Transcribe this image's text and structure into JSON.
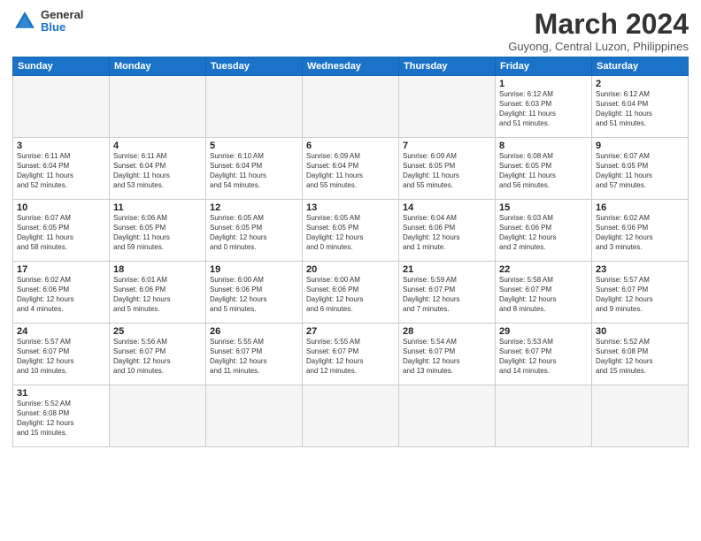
{
  "header": {
    "logo_line1": "General",
    "logo_line2": "Blue",
    "title": "March 2024",
    "subtitle": "Guyong, Central Luzon, Philippines"
  },
  "days_of_week": [
    "Sunday",
    "Monday",
    "Tuesday",
    "Wednesday",
    "Thursday",
    "Friday",
    "Saturday"
  ],
  "weeks": [
    [
      {
        "day": "",
        "info": "",
        "empty": true
      },
      {
        "day": "",
        "info": "",
        "empty": true
      },
      {
        "day": "",
        "info": "",
        "empty": true
      },
      {
        "day": "",
        "info": "",
        "empty": true
      },
      {
        "day": "",
        "info": "",
        "empty": true
      },
      {
        "day": "1",
        "info": "Sunrise: 6:12 AM\nSunset: 6:03 PM\nDaylight: 11 hours\nand 51 minutes."
      },
      {
        "day": "2",
        "info": "Sunrise: 6:12 AM\nSunset: 6:04 PM\nDaylight: 11 hours\nand 51 minutes."
      }
    ],
    [
      {
        "day": "3",
        "info": "Sunrise: 6:11 AM\nSunset: 6:04 PM\nDaylight: 11 hours\nand 52 minutes."
      },
      {
        "day": "4",
        "info": "Sunrise: 6:11 AM\nSunset: 6:04 PM\nDaylight: 11 hours\nand 53 minutes."
      },
      {
        "day": "5",
        "info": "Sunrise: 6:10 AM\nSunset: 6:04 PM\nDaylight: 11 hours\nand 54 minutes."
      },
      {
        "day": "6",
        "info": "Sunrise: 6:09 AM\nSunset: 6:04 PM\nDaylight: 11 hours\nand 55 minutes."
      },
      {
        "day": "7",
        "info": "Sunrise: 6:09 AM\nSunset: 6:05 PM\nDaylight: 11 hours\nand 55 minutes."
      },
      {
        "day": "8",
        "info": "Sunrise: 6:08 AM\nSunset: 6:05 PM\nDaylight: 11 hours\nand 56 minutes."
      },
      {
        "day": "9",
        "info": "Sunrise: 6:07 AM\nSunset: 6:05 PM\nDaylight: 11 hours\nand 57 minutes."
      }
    ],
    [
      {
        "day": "10",
        "info": "Sunrise: 6:07 AM\nSunset: 6:05 PM\nDaylight: 11 hours\nand 58 minutes."
      },
      {
        "day": "11",
        "info": "Sunrise: 6:06 AM\nSunset: 6:05 PM\nDaylight: 11 hours\nand 59 minutes."
      },
      {
        "day": "12",
        "info": "Sunrise: 6:05 AM\nSunset: 6:05 PM\nDaylight: 12 hours\nand 0 minutes."
      },
      {
        "day": "13",
        "info": "Sunrise: 6:05 AM\nSunset: 6:05 PM\nDaylight: 12 hours\nand 0 minutes."
      },
      {
        "day": "14",
        "info": "Sunrise: 6:04 AM\nSunset: 6:06 PM\nDaylight: 12 hours\nand 1 minute."
      },
      {
        "day": "15",
        "info": "Sunrise: 6:03 AM\nSunset: 6:06 PM\nDaylight: 12 hours\nand 2 minutes."
      },
      {
        "day": "16",
        "info": "Sunrise: 6:02 AM\nSunset: 6:06 PM\nDaylight: 12 hours\nand 3 minutes."
      }
    ],
    [
      {
        "day": "17",
        "info": "Sunrise: 6:02 AM\nSunset: 6:06 PM\nDaylight: 12 hours\nand 4 minutes."
      },
      {
        "day": "18",
        "info": "Sunrise: 6:01 AM\nSunset: 6:06 PM\nDaylight: 12 hours\nand 5 minutes."
      },
      {
        "day": "19",
        "info": "Sunrise: 6:00 AM\nSunset: 6:06 PM\nDaylight: 12 hours\nand 5 minutes."
      },
      {
        "day": "20",
        "info": "Sunrise: 6:00 AM\nSunset: 6:06 PM\nDaylight: 12 hours\nand 6 minutes."
      },
      {
        "day": "21",
        "info": "Sunrise: 5:59 AM\nSunset: 6:07 PM\nDaylight: 12 hours\nand 7 minutes."
      },
      {
        "day": "22",
        "info": "Sunrise: 5:58 AM\nSunset: 6:07 PM\nDaylight: 12 hours\nand 8 minutes."
      },
      {
        "day": "23",
        "info": "Sunrise: 5:57 AM\nSunset: 6:07 PM\nDaylight: 12 hours\nand 9 minutes."
      }
    ],
    [
      {
        "day": "24",
        "info": "Sunrise: 5:57 AM\nSunset: 6:07 PM\nDaylight: 12 hours\nand 10 minutes."
      },
      {
        "day": "25",
        "info": "Sunrise: 5:56 AM\nSunset: 6:07 PM\nDaylight: 12 hours\nand 10 minutes."
      },
      {
        "day": "26",
        "info": "Sunrise: 5:55 AM\nSunset: 6:07 PM\nDaylight: 12 hours\nand 11 minutes."
      },
      {
        "day": "27",
        "info": "Sunrise: 5:55 AM\nSunset: 6:07 PM\nDaylight: 12 hours\nand 12 minutes."
      },
      {
        "day": "28",
        "info": "Sunrise: 5:54 AM\nSunset: 6:07 PM\nDaylight: 12 hours\nand 13 minutes."
      },
      {
        "day": "29",
        "info": "Sunrise: 5:53 AM\nSunset: 6:07 PM\nDaylight: 12 hours\nand 14 minutes."
      },
      {
        "day": "30",
        "info": "Sunrise: 5:52 AM\nSunset: 6:08 PM\nDaylight: 12 hours\nand 15 minutes."
      }
    ],
    [
      {
        "day": "31",
        "info": "Sunrise: 5:52 AM\nSunset: 6:08 PM\nDaylight: 12 hours\nand 15 minutes."
      },
      {
        "day": "",
        "info": "",
        "empty": true
      },
      {
        "day": "",
        "info": "",
        "empty": true
      },
      {
        "day": "",
        "info": "",
        "empty": true
      },
      {
        "day": "",
        "info": "",
        "empty": true
      },
      {
        "day": "",
        "info": "",
        "empty": true
      },
      {
        "day": "",
        "info": "",
        "empty": true
      }
    ]
  ]
}
